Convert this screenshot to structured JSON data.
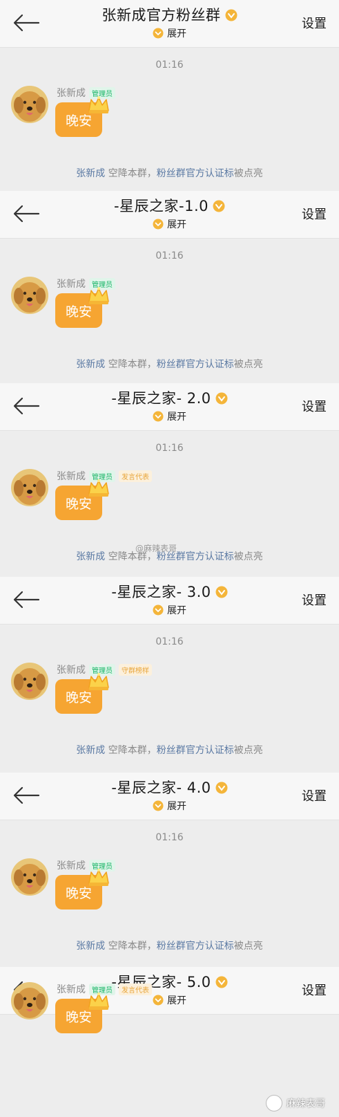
{
  "colors": {
    "bubble": "#f6a532",
    "link": "#5a79a3",
    "tag_green": "#18b566",
    "tag_orange": "#e8a53a",
    "background": "#ededed"
  },
  "panels": [
    {
      "title": "张新成官方粉丝群",
      "expand": "展开",
      "settings": "设置",
      "time": "01:16",
      "sender": "张新成",
      "tags": [
        "管理员"
      ],
      "message": "晚安",
      "notice": {
        "name": "张新成",
        "text1": " 空降本群，",
        "badge": "粉丝群官方认证标",
        "text2": "被点亮"
      }
    },
    {
      "title": "-星辰之家-1.0",
      "expand": "展开",
      "settings": "设置",
      "time": "01:16",
      "sender": "张新成",
      "tags": [
        "管理员"
      ],
      "message": "晚安",
      "notice": {
        "name": "张新成",
        "text1": " 空降本群，",
        "badge": "粉丝群官方认证标",
        "text2": "被点亮"
      }
    },
    {
      "title": "-星辰之家- 2.0",
      "expand": "展开",
      "settings": "设置",
      "time": "01:16",
      "sender": "张新成",
      "tags": [
        "管理员",
        "发言代表"
      ],
      "message": "晚安",
      "notice": {
        "name": "张新成",
        "text1": " 空降本群，",
        "badge": "粉丝群官方认证标",
        "text2": "被点亮"
      }
    },
    {
      "title": "-星辰之家- 3.0",
      "expand": "展开",
      "settings": "设置",
      "time": "01:16",
      "sender": "张新成",
      "tags": [
        "管理员",
        "守群榜样"
      ],
      "message": "晚安",
      "notice": {
        "name": "张新成",
        "text1": " 空降本群，",
        "badge": "粉丝群官方认证标",
        "text2": "被点亮"
      }
    },
    {
      "title": "-星辰之家- 4.0",
      "expand": "展开",
      "settings": "设置",
      "time": "01:16",
      "sender": "张新成",
      "tags": [
        "管理员"
      ],
      "message": "晚安",
      "notice": {
        "name": "张新成",
        "text1": " 空降本群，",
        "badge": "粉丝群官方认证标",
        "text2": "被点亮"
      }
    },
    {
      "title": "-星辰之家- 5.0",
      "expand": "展开",
      "settings": "设置",
      "time": "",
      "sender": "张新成",
      "tags": [
        "管理员",
        "发言代表"
      ],
      "message": "晚安",
      "notice": null
    }
  ],
  "watermarks": {
    "weibo": "@麻辣表哥",
    "bottom": "麻辣表哥"
  }
}
